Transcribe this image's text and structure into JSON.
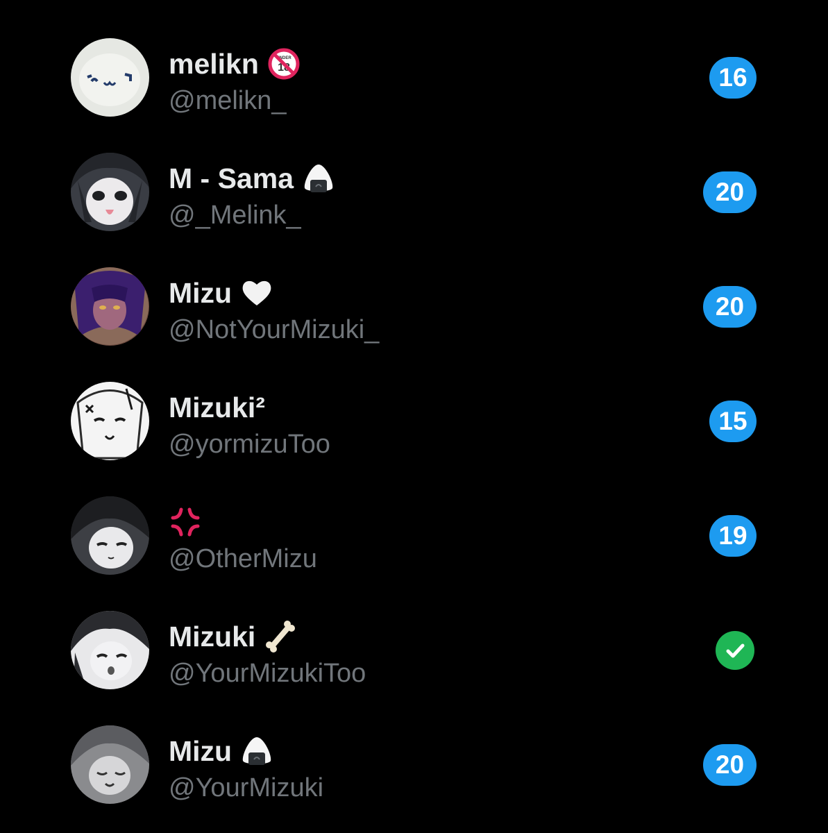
{
  "accounts": [
    {
      "display_name": "melikn",
      "emoji": "no-under-18-emoji",
      "handle": "@melikn_",
      "badge": "16"
    },
    {
      "display_name": "M - Sama",
      "emoji": "rice-ball-emoji",
      "handle": "@_Melink_",
      "badge": "20"
    },
    {
      "display_name": "Mizu",
      "emoji": "white-heart-emoji",
      "handle": "@NotYourMizuki_",
      "badge": "20"
    },
    {
      "display_name": "Mizuki²",
      "emoji": "",
      "handle": "@yormizuToo",
      "badge": "15"
    },
    {
      "display_name": "",
      "emoji": "anger-symbol-emoji",
      "handle": "@OtherMizu",
      "badge": "19"
    },
    {
      "display_name": "Mizuki",
      "emoji": "bone-emoji",
      "handle": "@YourMizukiToo",
      "badge": "",
      "status": "check-icon"
    },
    {
      "display_name": "Mizu",
      "emoji": "rice-ball-emoji",
      "handle": "@YourMizuki",
      "badge": "20"
    }
  ],
  "emoji_badge_text": "UNDER",
  "colors": {
    "background": "#000000",
    "name": "#e7e9ea",
    "handle": "#71767b",
    "badge": "#1d9bf0",
    "check": "#1fb655"
  }
}
